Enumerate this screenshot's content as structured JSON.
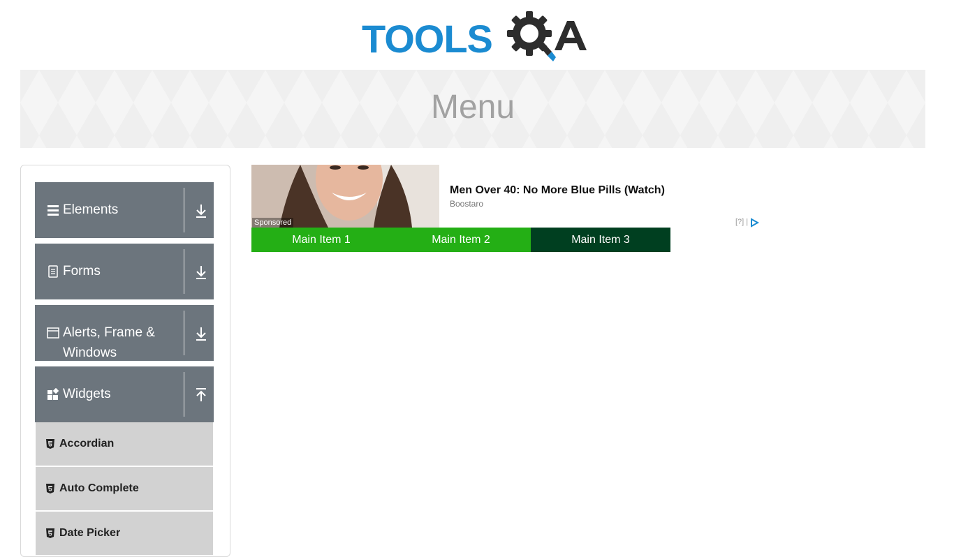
{
  "header": {
    "logo_text": "TOOLS",
    "logo_letter": "A",
    "logo_alt": "TOOLSQA"
  },
  "banner": {
    "title": "Menu"
  },
  "sidebar": {
    "groups": [
      {
        "label": "Elements",
        "icon": "hamburger-icon",
        "toggle": "expand-arrow-icon"
      },
      {
        "label": "Forms",
        "icon": "document-icon",
        "toggle": "expand-arrow-icon"
      },
      {
        "label": "Alerts, Frame & Windows",
        "icon": "window-icon",
        "toggle": "expand-arrow-icon"
      },
      {
        "label": "Widgets",
        "icon": "widgets-icon",
        "toggle": "collapse-arrow-icon"
      }
    ],
    "widgets_items": [
      {
        "label": "Accordian",
        "icon": "html5-icon"
      },
      {
        "label": "Auto Complete",
        "icon": "html5-icon"
      },
      {
        "label": "Date Picker",
        "icon": "html5-icon"
      }
    ]
  },
  "ad": {
    "sponsored_label": "Sponsored",
    "title": "Men Over 40: No More Blue Pills (Watch)",
    "source": "Boostaro",
    "help": "[?] |",
    "logo_icon": "adchoices-icon"
  },
  "menu": {
    "items": [
      {
        "label": "Main Item 1",
        "bg": "#24af15"
      },
      {
        "label": "Main Item 2",
        "bg": "#24af15"
      },
      {
        "label": "Main Item 3",
        "bg": "#003f20"
      }
    ]
  },
  "colors": {
    "logo_blue": "#1b8bd1",
    "logo_dark": "#2d2d2d",
    "group_bg": "#6c757d",
    "sub_item_bg": "#d2d2d2",
    "banner_text": "#a2a2a2"
  }
}
